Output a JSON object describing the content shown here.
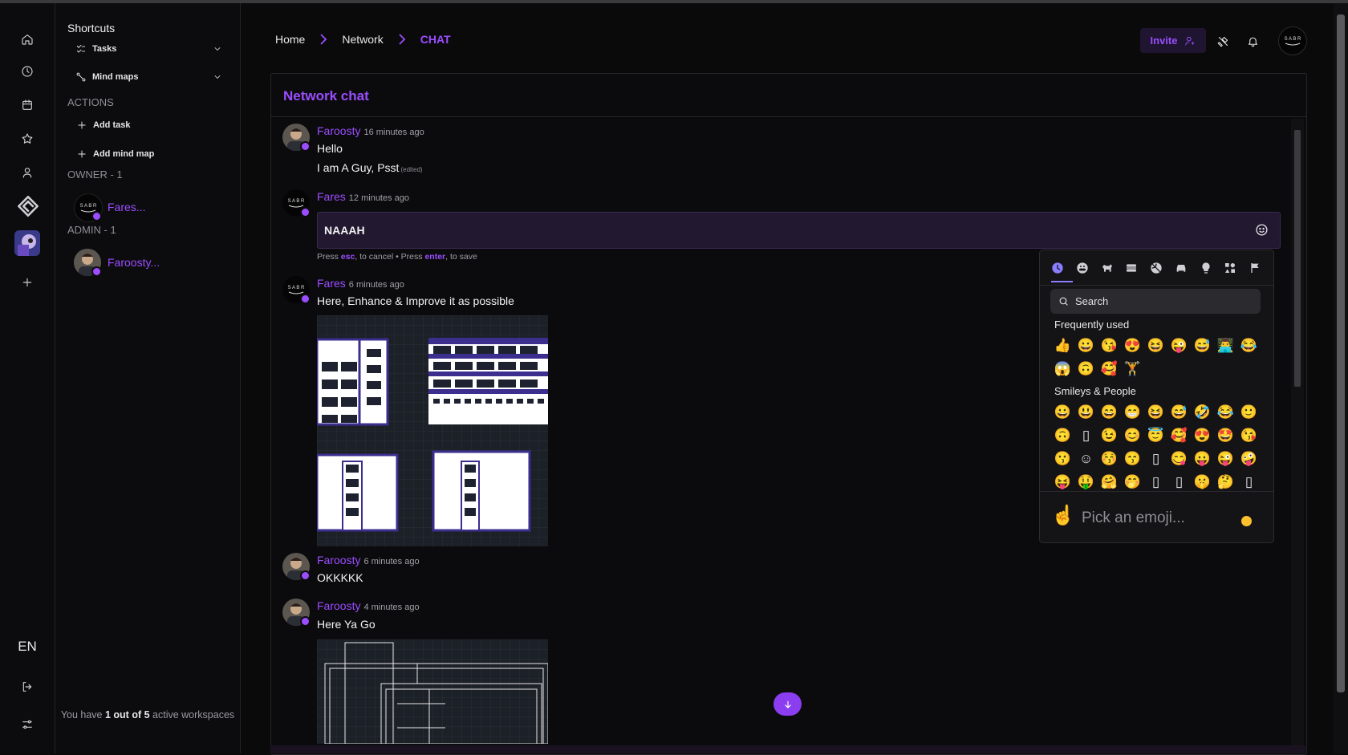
{
  "rail": {
    "icons": [
      "home-icon",
      "clock-icon",
      "calendar-icon",
      "star-icon",
      "user-icon",
      "workspace-logo-icon",
      "workspace-avatar",
      "plus-icon"
    ],
    "lang": "EN",
    "bottom_icons": [
      "logout-icon",
      "settings-sliders-icon"
    ]
  },
  "sidebar": {
    "title": "Shortcuts",
    "items": [
      {
        "label": "Tasks",
        "icon": "tasks-icon"
      },
      {
        "label": "Mind maps",
        "icon": "mind-map-icon"
      }
    ],
    "actions_label": "ACTIONS",
    "actions": [
      {
        "label": "Add task"
      },
      {
        "label": "Add mind map"
      }
    ],
    "owner_label": "OWNER - 1",
    "owner_name": "Fares...",
    "admin_label": "ADMIN - 1",
    "admin_name": "Faroosty...",
    "footer_prefix": "You have ",
    "footer_bold": "1 out of 5",
    "footer_suffix": " active workspaces",
    "accent": "#9b4dff"
  },
  "header": {
    "breadcrumbs": [
      "Home",
      "Network",
      "CHAT"
    ],
    "invite_label": "Invite",
    "icons": [
      "tools-icon",
      "bell-icon",
      "profile-avatar"
    ]
  },
  "chat": {
    "title": "Network chat",
    "messages": [
      {
        "author": "Faroosty",
        "time": "16 minutes ago",
        "lines": [
          "Hello",
          "I am A Guy, Psst"
        ],
        "edited": "(edited)"
      },
      {
        "author": "Fares",
        "time": "12 minutes ago",
        "edit_value": "NAAAH"
      },
      {
        "author": "Fares",
        "time": "6 minutes ago",
        "lines": [
          "Here, Enhance & Improve it as possible"
        ]
      },
      {
        "author": "Faroosty",
        "time": "6 minutes ago",
        "lines": [
          "OKKKKK"
        ]
      },
      {
        "author": "Faroosty",
        "time": "4 minutes ago",
        "lines": [
          "Here Ya Go"
        ]
      }
    ],
    "hint": {
      "press": "Press ",
      "esc": "esc",
      "cancel": ", to cancel • Press ",
      "enter": "enter",
      "save": ", to save"
    }
  },
  "emoji_picker": {
    "tabs": [
      "recent-icon",
      "smiley-icon",
      "animal-icon",
      "food-icon",
      "activity-icon",
      "car-icon",
      "bulb-icon",
      "symbols-icon",
      "flag-icon"
    ],
    "search_placeholder": "Search",
    "frequently_used_label": "Frequently used",
    "frequently_used": [
      "👍",
      "😀",
      "😘",
      "😍",
      "😆",
      "😜",
      "😅",
      "👨‍💻",
      "😂",
      "😱",
      "🙃",
      "🥰",
      "🏋"
    ],
    "smileys_label": "Smileys & People",
    "smileys": [
      "😀",
      "😃",
      "😄",
      "😁",
      "😆",
      "😅",
      "🤣",
      "😂",
      "🙂",
      "🙃",
      "▯",
      "😉",
      "😊",
      "😇",
      "🥰",
      "😍",
      "🤩",
      "😘",
      "😗",
      "☺",
      "😚",
      "😙",
      "▯",
      "😋",
      "😛",
      "😜",
      "🤪",
      "😝",
      "🤑",
      "🤗",
      "🤭",
      "▯",
      "▯",
      "🤫",
      "🤔",
      "▯"
    ],
    "preview_hand": "☝",
    "preview_text": "Pick an emoji..."
  }
}
